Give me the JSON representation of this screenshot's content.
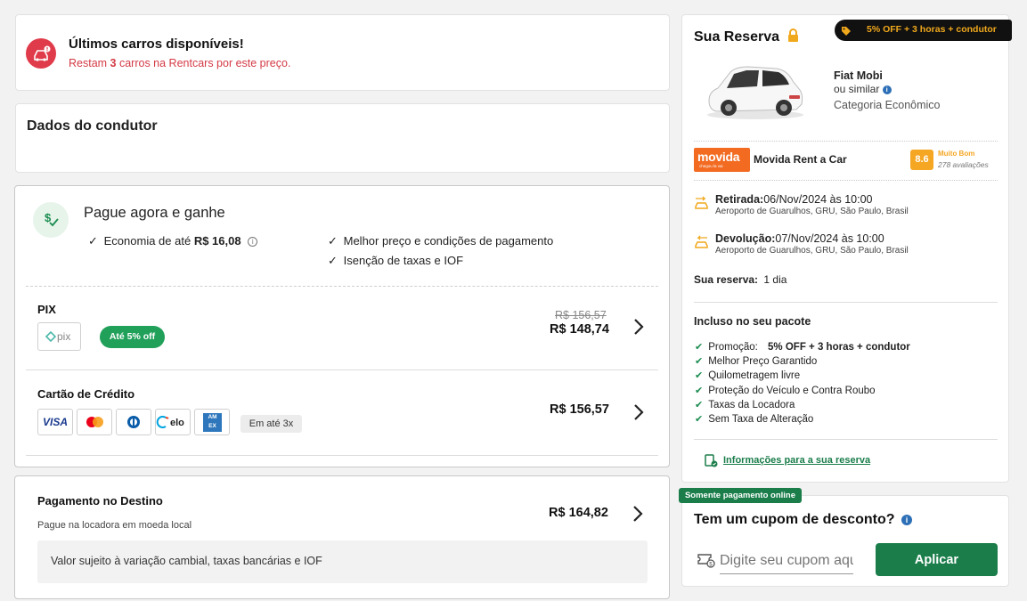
{
  "alert": {
    "title": "Últimos carros disponíveis!",
    "sub_prefix": "Restam ",
    "count": "3",
    "sub_suffix": " carros na Rentcars por este preço."
  },
  "driver": {
    "title": "Dados do condutor"
  },
  "pay_now": {
    "title": "Pague agora e ganhe",
    "saving_label": "Economia de até ",
    "saving_value": "R$ 16,08",
    "benefit_1": "Melhor preço e condições de pagamento",
    "benefit_2": "Isenção de taxas e IOF"
  },
  "pix": {
    "title": "PIX",
    "logo_text": "pix",
    "discount_badge": "Até 5% off",
    "old_price": "R$ 156,57",
    "price": "R$ 148,74"
  },
  "credit": {
    "title": "Cartão de Crédito",
    "brands": [
      "VISA",
      "mastercard",
      "diners",
      "elo",
      "AMEX"
    ],
    "installments": "Em até 3x",
    "price": "R$ 156,57"
  },
  "destino": {
    "title": "Pagamento no Destino",
    "sub": "Pague na locadora em moeda local",
    "price": "R$ 164,82",
    "note": "Valor sujeito à variação cambial, taxas bancárias e IOF"
  },
  "reserva": {
    "title": "Sua Reserva",
    "promo_badge": "5% OFF + 3 horas + condutor",
    "car_name": "Fiat Mobi",
    "car_similar": "ou similar",
    "car_category": "Categoria Econômico",
    "company_logo": "movida",
    "company_logo_sub": "chegou la vai",
    "company_name": "Movida Rent a Car",
    "rating_score": "8.6",
    "rating_label": "Muito Bom",
    "rating_count": "278 avaliações",
    "pickup_label": "Retirada:",
    "pickup_date": "06/Nov/2024 às 10:00",
    "pickup_place": "Aeroporto de Guarulhos, GRU, São Paulo, Brasil",
    "return_label": "Devolução:",
    "return_date": "07/Nov/2024 às 10:00",
    "return_place": "Aeroporto de Guarulhos, GRU, São Paulo, Brasil",
    "duration_label": "Sua reserva:",
    "duration_value": "1 dia",
    "included_title": "Incluso no seu pacote",
    "promo_line_label": "Promoção:",
    "promo_line_value": "5% OFF + 3 horas + condutor",
    "included": [
      "Melhor Preço Garantido",
      "Quilometragem livre",
      "Proteção do Veículo e Contra Roubo",
      "Taxas da Locadora",
      "Sem Taxa de Alteração"
    ],
    "info_link": "Informações para a sua reserva"
  },
  "cupom": {
    "tag": "Somente pagamento online",
    "title": "Tem um cupom de desconto?",
    "placeholder": "Digite seu cupom aqui",
    "apply": "Aplicar"
  },
  "colors": {
    "alert_red": "#e03b4a",
    "brand_green": "#1a7d4a",
    "discount_green": "#21a05a",
    "movida_orange": "#f26b21",
    "rating_orange": "#f5a623",
    "lock_gold": "#f0a81c"
  }
}
